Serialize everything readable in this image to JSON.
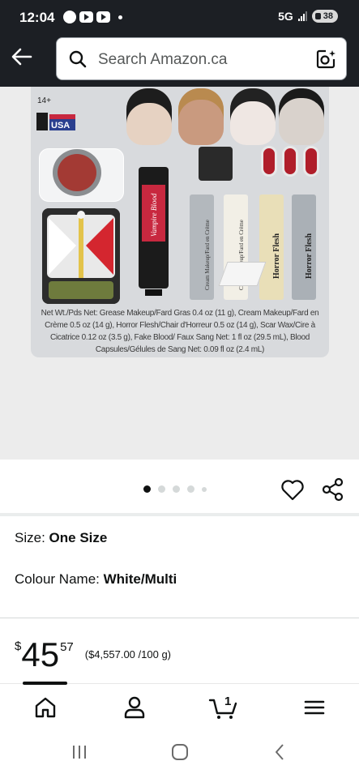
{
  "status_bar": {
    "time": "12:04",
    "network": "5G",
    "battery": "38"
  },
  "header": {
    "search_placeholder": "Search Amazon.ca"
  },
  "product_image": {
    "age_label": "14+",
    "flag_text": "USA",
    "tube_label": "Vampire Blood",
    "cream_labels": [
      "Cream Makeup/Fard en Crème",
      "Horror Flesh",
      "Horror Flesh"
    ],
    "net_contents": "Net Wt./Pds Net: Grease Makeup/Fard Gras 0.4 oz (11 g), Cream Makeup/Fard en Crème 0.5 oz (14 g), Horror Flesh/Chair d'Horreur 0.5 oz (14 g), Scar Wax/Cire à Cicatrice 0.12 oz (3.5 g), Fake Blood/ Faux Sang Net: 1 fl oz (29.5 mL), Blood Capsules/Gélules de Sang Net: 0.09 fl oz (2.4 mL)"
  },
  "carousel": {
    "total_dots": 5,
    "active_index": 0
  },
  "variants": {
    "size_label": "Size: ",
    "size_value": "One Size",
    "colour_label": "Colour Name: ",
    "colour_value": "White/Multi"
  },
  "price": {
    "currency": "$",
    "dollars": "45",
    "cents": "57",
    "unit_price": "($4,557.00 /100 g)"
  },
  "bottom_nav": {
    "cart_count": "1",
    "items": [
      "home-icon",
      "account-icon",
      "cart-icon",
      "menu-icon"
    ]
  },
  "colors": {
    "header_bg": "#1c1f24",
    "blood_red": "#b01e2a"
  }
}
